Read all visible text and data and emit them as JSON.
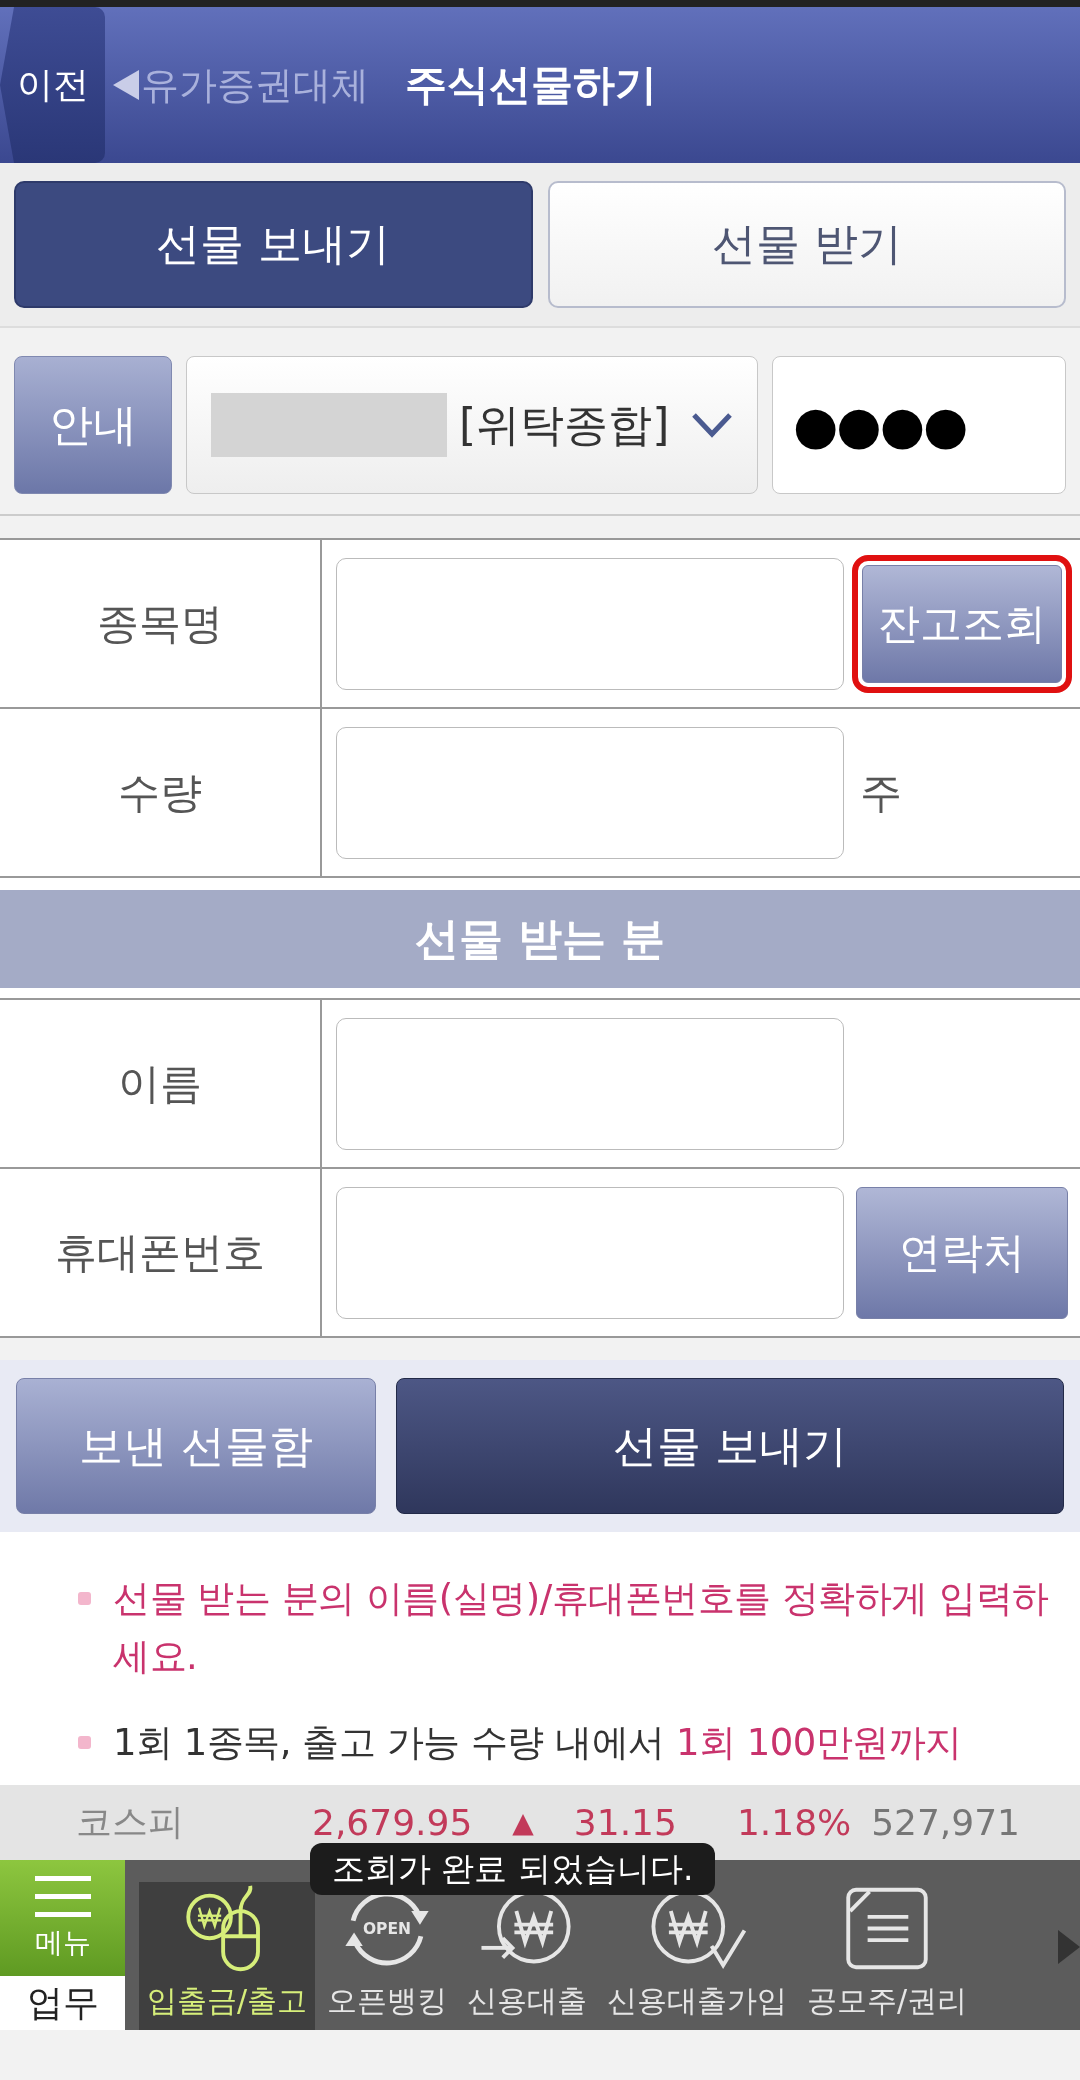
{
  "header": {
    "back_button": "이전",
    "breadcrumb": "유가증권대체",
    "title": "주식선물하기"
  },
  "tabs": [
    {
      "label": "선물 보내기",
      "selected": true
    },
    {
      "label": "선물 받기",
      "selected": false
    }
  ],
  "account": {
    "info_button": "안내",
    "account_type": "[위탁종합]",
    "password": "●●●●"
  },
  "stock_form": [
    {
      "label": "종목명",
      "button": "잔고조회",
      "highlighted": true
    },
    {
      "label": "수량",
      "unit": "주"
    }
  ],
  "recipient": {
    "heading": "선물 받는 분",
    "rows": [
      {
        "label": "이름"
      },
      {
        "label": "휴대폰번호",
        "button": "연락처",
        "highlighted": false
      }
    ]
  },
  "actions": [
    {
      "label": "보낸 선물함",
      "kind": "secondary"
    },
    {
      "label": "선물 보내기",
      "kind": "primary"
    }
  ],
  "notes": [
    {
      "segments": [
        {
          "text": "선물 받는 분의 이름(실명)/휴대폰번호를 정확하게 입력하세요.",
          "highlight": true
        }
      ]
    },
    {
      "segments": [
        {
          "text": "1회 1종목, 출고 가능 수량 내에서 ",
          "highlight": false
        },
        {
          "text": "1회 100만원까지",
          "highlight": true
        }
      ]
    }
  ],
  "ticker": {
    "index": "코스피",
    "value": "2,679.95",
    "change_mark": "▲",
    "change": "31.15",
    "rate": "1.18%",
    "volume": "527,971"
  },
  "toast": "조회가 완료 되었습니다.",
  "bottom_nav": {
    "menu_label": "메뉴",
    "section_label": "업무",
    "items": [
      {
        "label": "입출금/출고",
        "selected": true
      },
      {
        "label": "오픈뱅킹",
        "selected": false,
        "icon_text": "OPEN"
      },
      {
        "label": "신용대출",
        "selected": false
      },
      {
        "label": "신용대출가입",
        "selected": false
      },
      {
        "label": "공모주/권리",
        "selected": false
      }
    ]
  }
}
